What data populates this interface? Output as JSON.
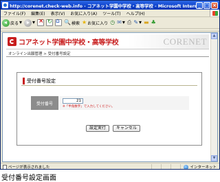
{
  "window": {
    "title": "http://corenet.check-web.info - コアネット学園中学校・高等学校 - Microsoft Internet Explo..."
  },
  "menubar": {
    "items": [
      "ファイル(F)",
      "編集(E)",
      "表示(V)",
      "お気に入り(A)",
      "ツール(T)",
      "ヘルプ(H)"
    ]
  },
  "toolbar": {
    "back_label": "戻る",
    "search_label": "検索",
    "favorites_label": "お気に入り"
  },
  "header": {
    "school_name": "コアネット学園中学校・高等学校",
    "brand": "CORENET"
  },
  "breadcrumb": "オンライン出願管理 > 受付番号設定",
  "panel": {
    "title": "受付番号設定",
    "field_label": "受付番号",
    "field_value": "21",
    "hint": "※「半角数字」で入力してください。"
  },
  "buttons": {
    "submit": "設定実行",
    "cancel": "キャンセル"
  },
  "statusbar": {
    "message": "ページが表示されました",
    "zone": "インターネット"
  },
  "caption": "受付番号設定画面",
  "colors": {
    "accent": "#C81E1E",
    "titlebar": "#0B3FC9",
    "label_bg": "#8C8C8C"
  }
}
